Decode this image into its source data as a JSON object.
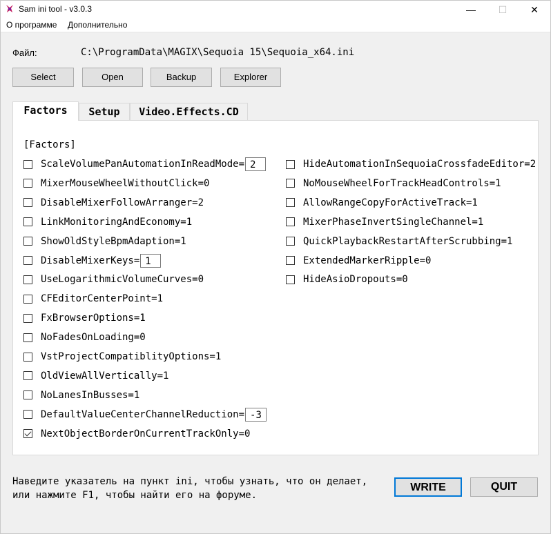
{
  "window": {
    "title": "Sam ini tool - v3.0.3",
    "minimize": "—",
    "maximize": "☐",
    "close": "✕"
  },
  "menu": [
    "О программе",
    "Дополнительно"
  ],
  "file": {
    "label": "Файл:",
    "path": "C:\\ProgramData\\MAGIX\\Sequoia 15\\Sequoia_x64.ini"
  },
  "buttons": {
    "select": "Select",
    "open": "Open",
    "backup": "Backup",
    "explorer": "Explorer"
  },
  "tabs": [
    "Factors",
    "Setup",
    "Video.Effects.CD"
  ],
  "section": "[Factors]",
  "left_items": [
    {
      "label": "ScaleVolumePanAutomationInReadMode=",
      "value": "2",
      "checked": false
    },
    {
      "label": "MixerMouseWheelWithoutClick=0",
      "checked": false
    },
    {
      "label": "DisableMixerFollowArranger=2",
      "checked": false
    },
    {
      "label": "LinkMonitoringAndEconomy=1",
      "checked": false
    },
    {
      "label": "ShowOldStyleBpmAdaption=1",
      "checked": false
    },
    {
      "label": "DisableMixerKeys=",
      "value": "1",
      "checked": false
    },
    {
      "label": "UseLogarithmicVolumeCurves=0",
      "checked": false
    },
    {
      "label": "CFEditorCenterPoint=1",
      "checked": false
    },
    {
      "label": "FxBrowserOptions=1",
      "checked": false
    },
    {
      "label": "NoFadesOnLoading=0",
      "checked": false
    },
    {
      "label": "VstProjectCompatiblityOptions=1",
      "checked": false
    },
    {
      "label": "OldViewAllVertically=1",
      "checked": false
    },
    {
      "label": "NoLanesInBusses=1",
      "checked": false
    },
    {
      "label": "DefaultValueCenterChannelReduction=",
      "value": "-3",
      "checked": false
    },
    {
      "label": "NextObjectBorderOnCurrentTrackOnly=0",
      "checked": true
    }
  ],
  "right_items": [
    {
      "label": "HideAutomationInSequoiaCrossfadeEditor=2",
      "checked": false
    },
    {
      "label": "NoMouseWheelForTrackHeadControls=1",
      "checked": false
    },
    {
      "label": "AllowRangeCopyForActiveTrack=1",
      "checked": false
    },
    {
      "label": "MixerPhaseInvertSingleChannel=1",
      "checked": false
    },
    {
      "label": "QuickPlaybackRestartAfterScrubbing=1",
      "checked": false
    },
    {
      "label": "ExtendedMarkerRipple=0",
      "checked": false
    },
    {
      "label": "HideAsioDropouts=0",
      "checked": false
    }
  ],
  "hint": [
    "Наведите указатель на пункт ini, чтобы узнать, что он делает,",
    "или нажмите F1, чтобы найти его на форуме."
  ],
  "actions": {
    "write": "WRITE",
    "quit": "QUIT"
  }
}
